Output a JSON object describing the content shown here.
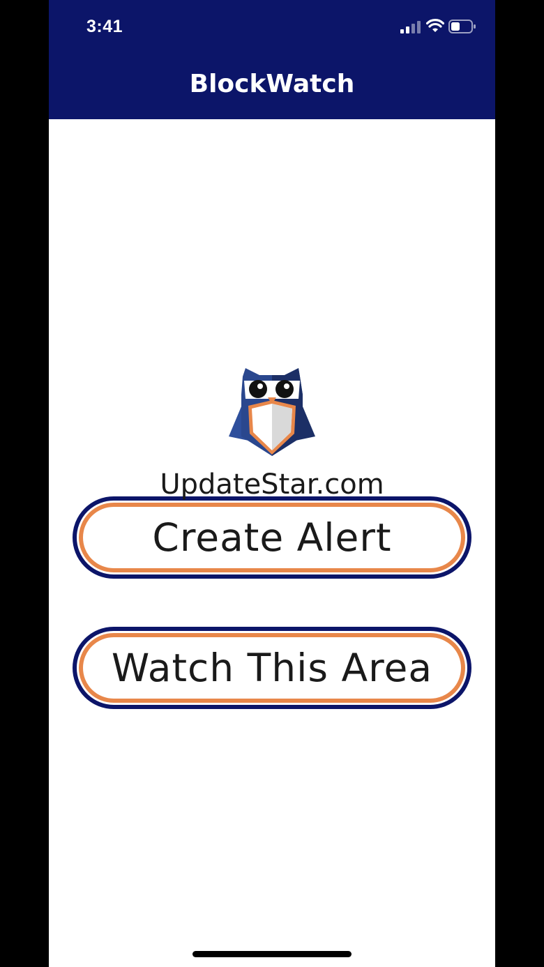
{
  "status_bar": {
    "time": "3:41"
  },
  "header": {
    "title": "BlockWatch"
  },
  "logo": {
    "icon": "owl-shield-icon"
  },
  "watermark": {
    "text": "UpdateStar.com"
  },
  "buttons": {
    "create_alert": "Create Alert",
    "watch_area": "Watch This Area"
  },
  "colors": {
    "header_bg": "#0c1569",
    "button_outer_border": "#0c1569",
    "button_inner_border": "#e8874a"
  }
}
